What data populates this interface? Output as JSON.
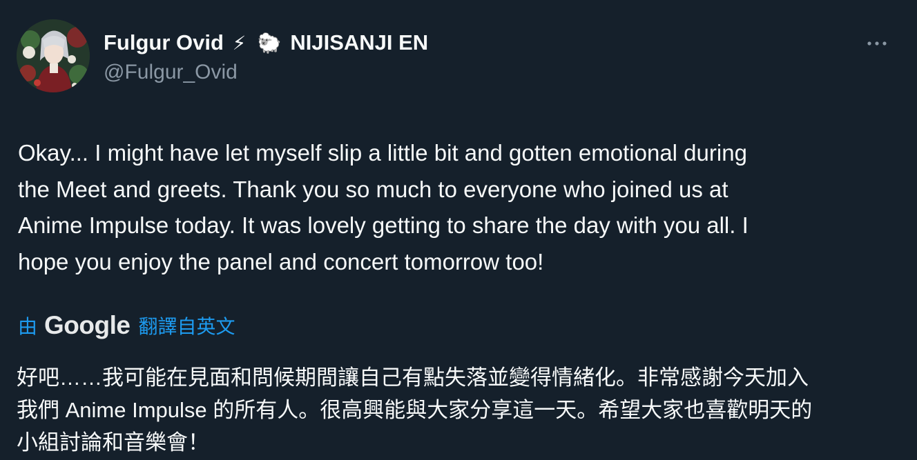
{
  "author": {
    "display_name": "Fulgur Ovid",
    "emoji_1": "⚡",
    "emoji_2": "🐑",
    "affiliation": "NIJISANJI EN",
    "handle": "@Fulgur_Ovid"
  },
  "tweet": {
    "text": "Okay... I might have let myself slip a little bit and gotten emotional during\nthe Meet and greets. Thank you so much to everyone who joined us at\nAnime Impulse today. It was lovely getting to share the day with you all. I\nhope you enjoy the panel and concert tomorrow too!"
  },
  "translation": {
    "prefix": "由",
    "provider": "Google",
    "suffix": "翻譯自英文",
    "text": "好吧……我可能在見面和問候期間讓自己有點失落並變得情緒化。非常感謝今天加入\n我們 Anime Impulse 的所有人。很高興能與大家分享這一天。希望大家也喜歡明天的\n小組討論和音樂會！"
  },
  "icons": {
    "more": "more-horizontal-icon",
    "avatar": "profile-avatar"
  },
  "colors": {
    "background": "#15202b",
    "text": "#f7f9f9",
    "secondary": "#8b98a5",
    "link": "#1d9bf0"
  }
}
